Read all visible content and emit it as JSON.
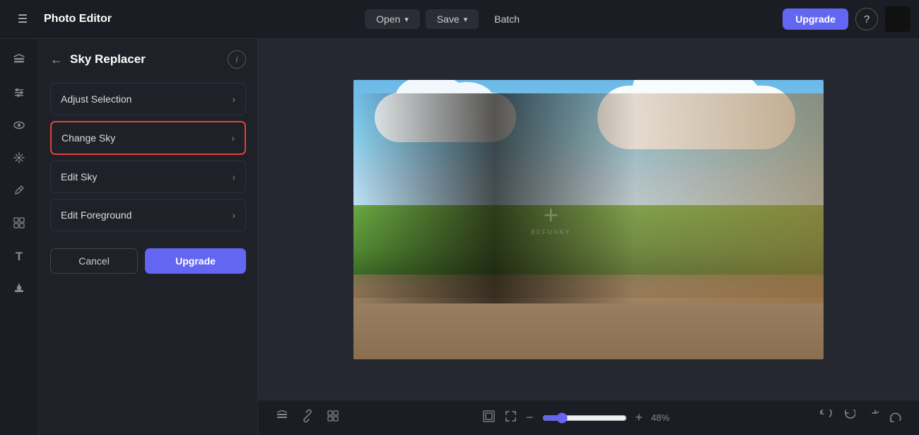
{
  "app": {
    "title": "Photo Editor"
  },
  "topbar": {
    "open_label": "Open",
    "save_label": "Save",
    "batch_label": "Batch",
    "upgrade_label": "Upgrade",
    "help_label": "?"
  },
  "panel": {
    "title": "Sky Replacer",
    "menu_items": [
      {
        "id": "adjust-selection",
        "label": "Adjust Selection",
        "active": false
      },
      {
        "id": "change-sky",
        "label": "Change Sky",
        "active": true
      },
      {
        "id": "edit-sky",
        "label": "Edit Sky",
        "active": false
      },
      {
        "id": "edit-foreground",
        "label": "Edit Foreground",
        "active": false
      }
    ],
    "cancel_label": "Cancel",
    "upgrade_label": "Upgrade"
  },
  "bottom": {
    "zoom_value": "48",
    "zoom_unit": "%",
    "zoom_display": "48%"
  },
  "icons": {
    "hamburger": "☰",
    "back": "←",
    "info": "i",
    "layers": "⊞",
    "adjustments": "⊕",
    "eye": "◉",
    "sparkle": "✦",
    "brush": "✏",
    "grid": "⊞",
    "text": "T",
    "stamp": "◈",
    "fit": "⛶",
    "fitframe": "⤢",
    "zoomin": "+",
    "zoomout": "−",
    "undo2": "↺",
    "undo": "↩",
    "redo": "↪",
    "redo2": "↻",
    "layers2": "◧",
    "link": "⛓",
    "grid2": "⊟",
    "chevron": "›"
  }
}
